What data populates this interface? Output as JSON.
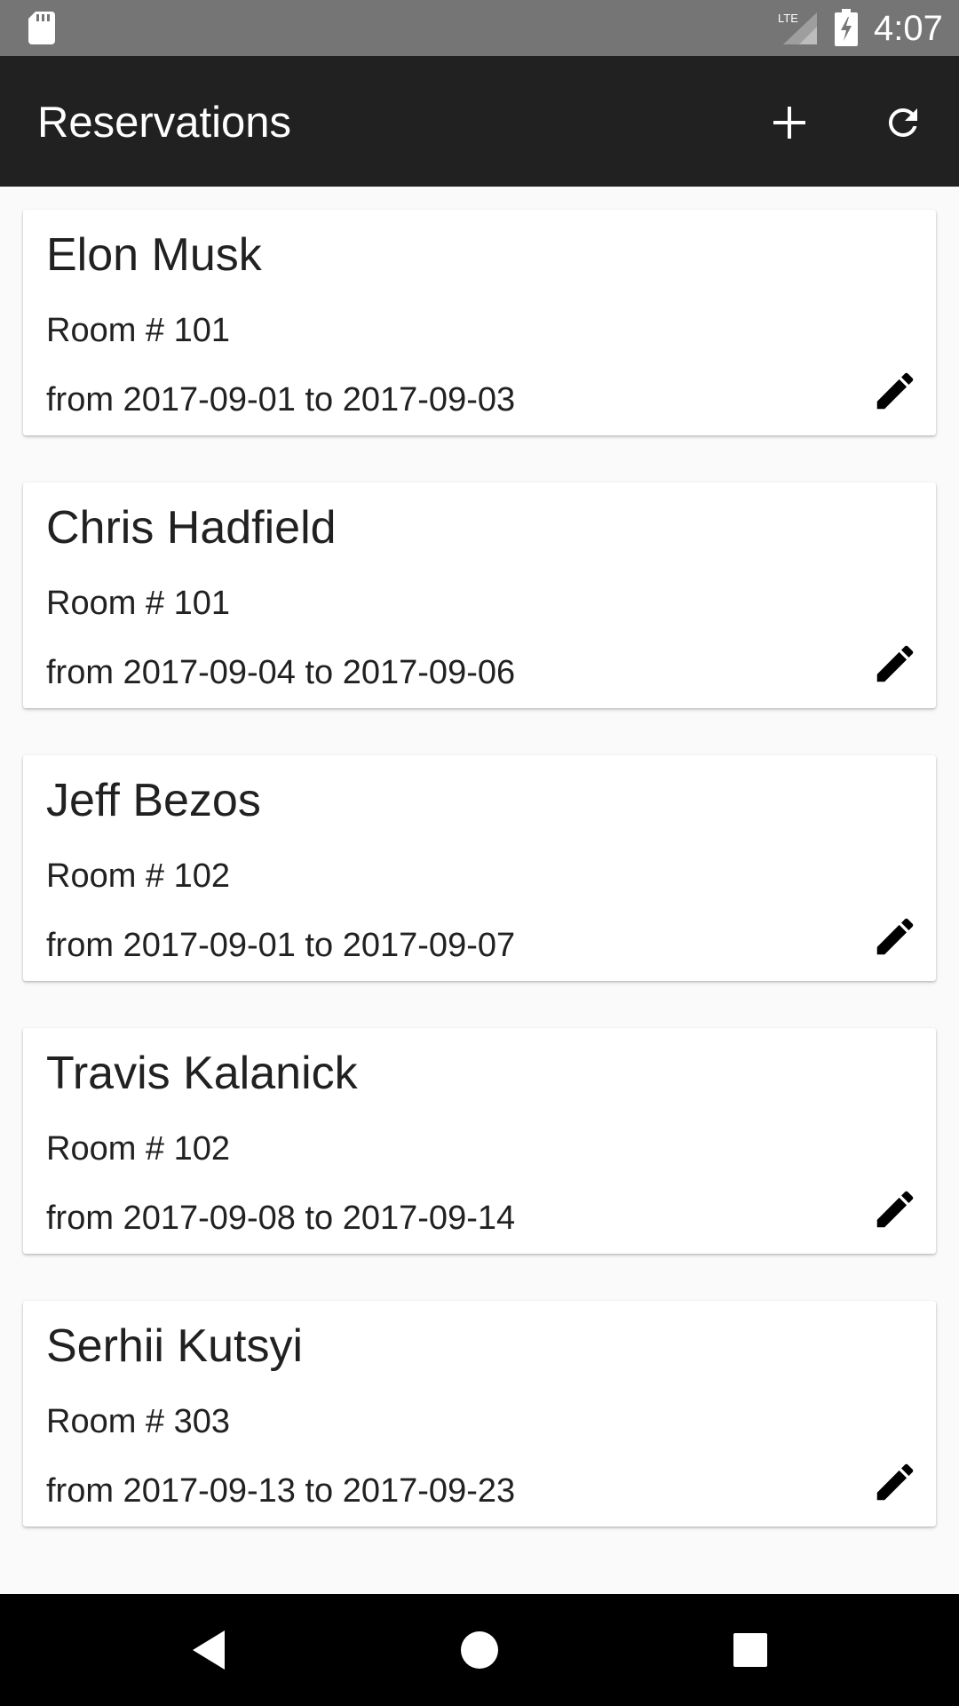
{
  "status_bar": {
    "time": "4:07",
    "network_label": "LTE",
    "icons": [
      "sd-card-icon",
      "signal-icon",
      "battery-charging-icon"
    ]
  },
  "app_bar": {
    "title": "Reservations",
    "actions": [
      {
        "name": "add-reservation-button",
        "icon": "plus-icon"
      },
      {
        "name": "refresh-button",
        "icon": "refresh-icon"
      }
    ]
  },
  "reservations": [
    {
      "name": "Elon Musk",
      "room": "Room # 101",
      "dates": "from 2017-09-01 to 2017-09-03"
    },
    {
      "name": "Chris Hadfield",
      "room": "Room # 101",
      "dates": "from 2017-09-04 to 2017-09-06"
    },
    {
      "name": "Jeff Bezos",
      "room": "Room # 102",
      "dates": "from 2017-09-01 to 2017-09-07"
    },
    {
      "name": "Travis Kalanick",
      "room": "Room # 102",
      "dates": "from 2017-09-08 to 2017-09-14"
    },
    {
      "name": "Serhii Kutsyi",
      "room": "Room # 303",
      "dates": "from 2017-09-13 to 2017-09-23"
    }
  ],
  "nav_bar": {
    "buttons": [
      "back-icon",
      "home-icon",
      "recents-icon"
    ]
  },
  "colors": {
    "status_bar": "#757575",
    "app_bar": "#212121",
    "background": "#fafafa",
    "card": "#ffffff",
    "text": "#212121",
    "nav_bar": "#000000"
  }
}
